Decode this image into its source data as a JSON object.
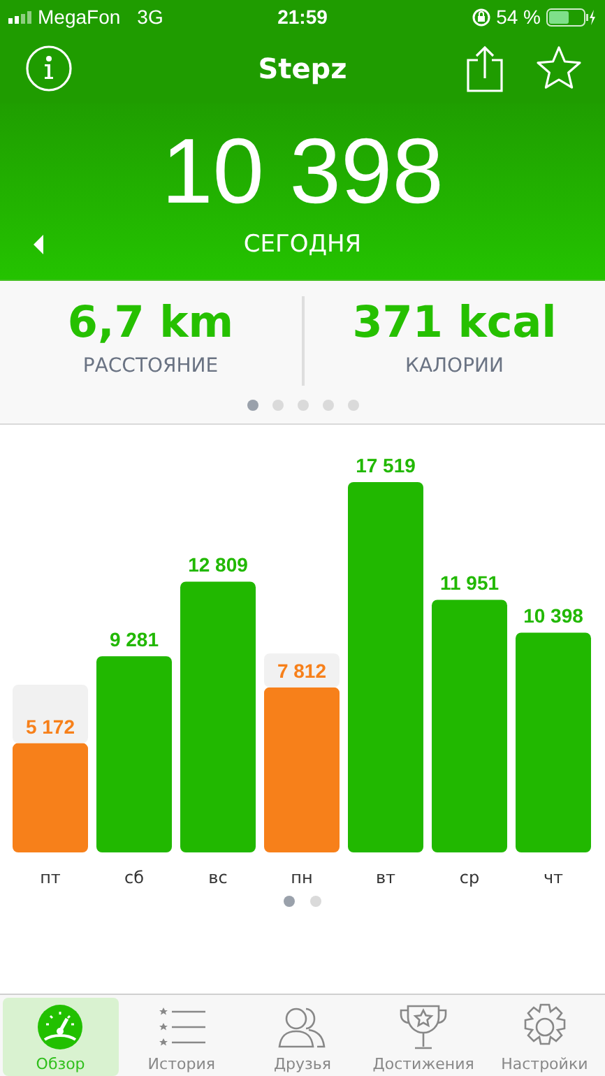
{
  "status_bar": {
    "carrier": "MegaFon",
    "network": "3G",
    "time": "21:59",
    "battery": "54 %"
  },
  "nav": {
    "title": "Stepz"
  },
  "hero": {
    "steps": "10 398",
    "label": "СЕГОДНЯ"
  },
  "stats": [
    {
      "value": "6,7 km",
      "label": "РАССТОЯНИЕ"
    },
    {
      "value": "371 kcal",
      "label": "КАЛОРИИ"
    }
  ],
  "stats_pages": [
    {
      "selected": true
    },
    {
      "selected": false
    },
    {
      "selected": false
    },
    {
      "selected": false
    },
    {
      "selected": false
    }
  ],
  "chart": {
    "chart_data": {
      "type": "bar",
      "categories": [
        "пт",
        "сб",
        "вс",
        "пн",
        "вт",
        "ср",
        "чт"
      ],
      "stacked": true,
      "data_labels": true,
      "ylim": [
        0,
        17519
      ],
      "series": [
        {
          "color": "#21b800",
          "values": [
            null,
            9281,
            12809,
            null,
            17519,
            11951,
            10398
          ]
        },
        {
          "color": "#f7801a",
          "values": [
            5172,
            null,
            null,
            7812,
            null,
            null,
            null
          ]
        },
        {
          "color": "#f1f1f1",
          "values": [
            2760,
            null,
            null,
            1600,
            null,
            null,
            null
          ],
          "value_labels": [
            null,
            null,
            null,
            null,
            null,
            null,
            null
          ]
        }
      ]
    }
  },
  "chart_pages": [
    {
      "selected": true
    },
    {
      "selected": false
    }
  ],
  "tabs": [
    {
      "label": "Обзор",
      "selected": true
    },
    {
      "label": "История",
      "selected": false
    },
    {
      "label": "Друзья",
      "selected": false
    },
    {
      "label": "Достижения",
      "selected": false
    },
    {
      "label": "Настройки",
      "selected": false
    }
  ]
}
